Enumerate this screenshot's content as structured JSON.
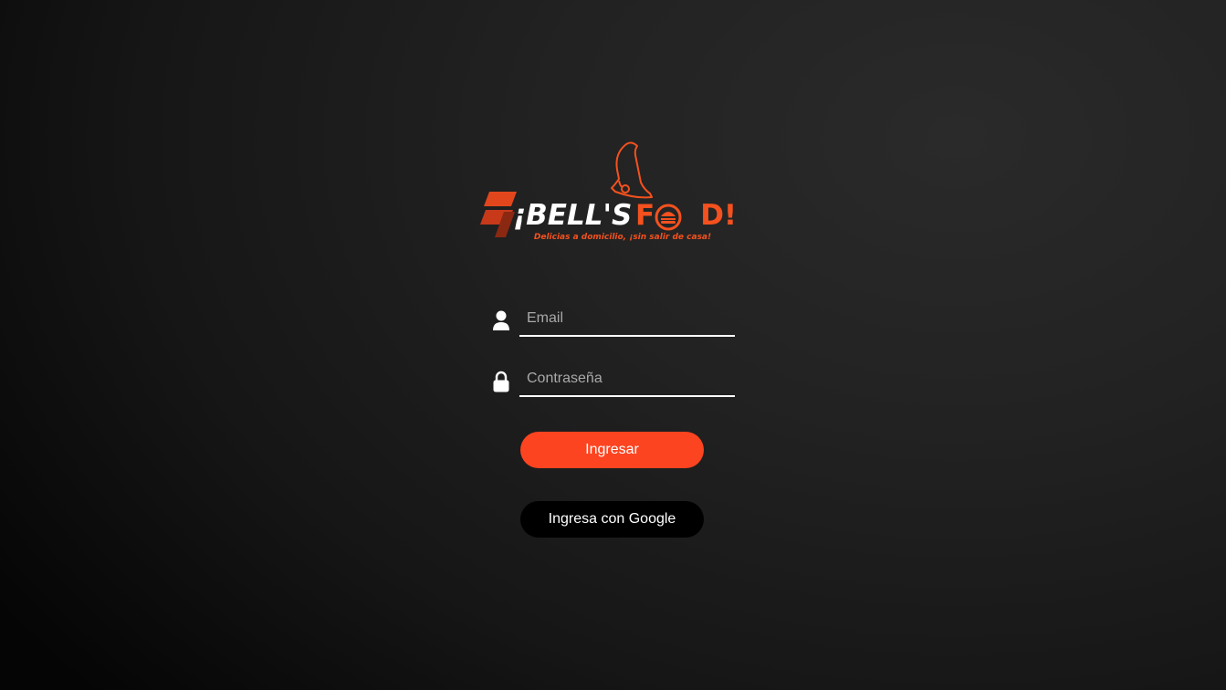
{
  "brand": {
    "name_part1": "¡BELL'S",
    "name_part2": "FOOD!",
    "tagline": "Delicias a domicilio, ¡sin salir de casa!",
    "accent_color": "#f4511e"
  },
  "login": {
    "email": {
      "placeholder": "Email",
      "value": "",
      "icon": "user-icon"
    },
    "password": {
      "placeholder": "Contraseña",
      "value": "",
      "icon": "lock-icon"
    },
    "submit_label": "Ingresar",
    "submit_color": "#fd4420",
    "google_label": "Ingresa con Google",
    "google_color": "#000000"
  }
}
